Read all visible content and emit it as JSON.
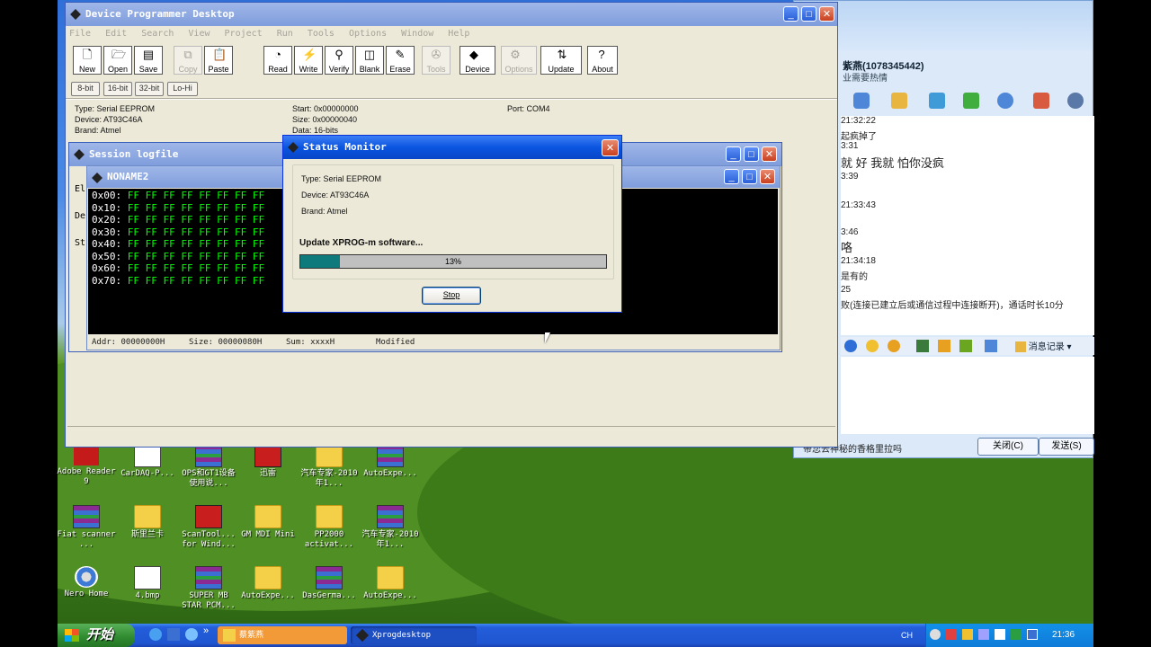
{
  "main_window": {
    "title": "Device Programmer Desktop",
    "menu": [
      "File",
      "Edit",
      "Search",
      "View",
      "Project",
      "Run",
      "Tools",
      "Options",
      "Window",
      "Help"
    ],
    "toolbar": [
      {
        "label": "New",
        "icon": "new-file-icon",
        "enabled": true
      },
      {
        "label": "Open",
        "icon": "open-file-icon",
        "enabled": true
      },
      {
        "label": "Save",
        "icon": "save-icon",
        "enabled": true
      },
      {
        "label": "Copy",
        "icon": "copy-icon",
        "enabled": false
      },
      {
        "label": "Paste",
        "icon": "paste-icon",
        "enabled": true
      },
      {
        "label": "Read",
        "icon": "read-icon",
        "enabled": true
      },
      {
        "label": "Write",
        "icon": "write-icon",
        "enabled": true
      },
      {
        "label": "Verify",
        "icon": "verify-icon",
        "enabled": true
      },
      {
        "label": "Blank",
        "icon": "blank-icon",
        "enabled": true
      },
      {
        "label": "Erase",
        "icon": "erase-icon",
        "enabled": true
      },
      {
        "label": "Tools",
        "icon": "tools-icon",
        "enabled": false
      },
      {
        "label": "Device",
        "icon": "device-icon",
        "enabled": true
      },
      {
        "label": "Options",
        "icon": "options-icon",
        "enabled": false
      },
      {
        "label": "Update",
        "icon": "update-icon",
        "enabled": true
      },
      {
        "label": "About",
        "icon": "about-icon",
        "enabled": true
      }
    ],
    "bit_buttons": [
      "8-bit",
      "16-bit",
      "32-bit",
      "Lo-Hi"
    ],
    "info": {
      "type": "Type: Serial EEPROM",
      "device": "Device: AT93C46A",
      "brand": "Brand: Atmel",
      "start": "Start: 0x00000000",
      "size": "Size: 0x00000040",
      "data": "Data: 16-bits",
      "port": "Port: COM4"
    }
  },
  "session_window": {
    "title": "Session logfile",
    "side_chars": [
      "El",
      "De",
      "St"
    ]
  },
  "hex_window": {
    "title": "NONAME2",
    "rows": [
      {
        "addr": "0x00:",
        "bytes": "FF FF FF FF FF FF FF FF"
      },
      {
        "addr": "0x10:",
        "bytes": "FF FF FF FF FF FF FF FF"
      },
      {
        "addr": "0x20:",
        "bytes": "FF FF FF FF FF FF FF FF"
      },
      {
        "addr": "0x30:",
        "bytes": "FF FF FF FF FF FF FF FF"
      },
      {
        "addr": "0x40:",
        "bytes": "FF FF FF FF FF FF FF FF"
      },
      {
        "addr": "0x50:",
        "bytes": "FF FF FF FF FF FF FF FF"
      },
      {
        "addr": "0x60:",
        "bytes": "FF FF FF FF FF FF FF FF"
      },
      {
        "addr": "0x70:",
        "bytes": "FF FF FF FF FF FF FF FF"
      }
    ],
    "status": {
      "addr": "Addr: 00000000H",
      "size": "Size: 00000080H",
      "sum": "Sum: xxxxH",
      "modified": "Modified"
    }
  },
  "status_dialog": {
    "title": "Status Monitor",
    "type": "Type: Serial EEPROM",
    "device": "Device: AT93C46A",
    "brand": "Brand: Atmel",
    "message": "Update XPROG-m software...",
    "progress_text": "13%",
    "progress": 0.13,
    "stop_label": "Stop"
  },
  "chat": {
    "header_name": "紫燕(1078345442)",
    "header_sub": "业需要热情",
    "lines": [
      {
        "text": "21:32:22",
        "kind": "time"
      },
      {
        "text": "起疯掉了",
        "kind": "msg"
      },
      {
        "text": "3:31",
        "kind": "time"
      },
      {
        "text": "就 好   我就 怕你没疯",
        "kind": "big"
      },
      {
        "text": "3:39",
        "kind": "time"
      },
      {
        "text": "21:33:43",
        "kind": "time"
      },
      {
        "text": "3:46",
        "kind": "time"
      },
      {
        "text": "咯",
        "kind": "big"
      },
      {
        "text": "21:34:18",
        "kind": "time"
      },
      {
        "text": "是有的",
        "kind": "msg"
      },
      {
        "text": "25",
        "kind": "time"
      },
      {
        "text": "败(连接已建立后或通信过程中连接断开)，通话时长10分",
        "kind": "msg"
      }
    ],
    "input_tool_label": "消息记录",
    "ad_text": "带您去神秘的香格里拉吗",
    "close_label": "关闭(C)",
    "send_label": "发送(S)"
  },
  "desktop_icons": [
    {
      "label": "Adobe Reader 9",
      "kind": "pdf"
    },
    {
      "label": "CarDAQ-P...",
      "kind": "doc"
    },
    {
      "label": "OPS和GT1设备使用说...",
      "kind": "rar"
    },
    {
      "label": "迅雷",
      "kind": "app"
    },
    {
      "label": "汽车专家-2010年1...",
      "kind": "folder"
    },
    {
      "label": "AutoExpe...",
      "kind": "rar"
    },
    {
      "label": "Fiat scanner ...",
      "kind": "rar"
    },
    {
      "label": "斯里兰卡",
      "kind": "folder"
    },
    {
      "label": "ScanTool... for Wind...",
      "kind": "app"
    },
    {
      "label": "GM MDI Mini",
      "kind": "folder"
    },
    {
      "label": "PP2000 activat...",
      "kind": "folder"
    },
    {
      "label": "汽车专家-2010年1...",
      "kind": "rar"
    },
    {
      "label": "Nero Home",
      "kind": "cd"
    },
    {
      "label": "4.bmp",
      "kind": "doc"
    },
    {
      "label": "SUPER MB STAR PCM...",
      "kind": "rar"
    },
    {
      "label": "AutoExpe...",
      "kind": "folder"
    },
    {
      "label": "DasGerma...",
      "kind": "rar"
    },
    {
      "label": "AutoExpe...",
      "kind": "folder"
    }
  ],
  "taskbar": {
    "start_label": "开始",
    "tasks": [
      {
        "label": "蔡紫燕",
        "icon": "chat-task-icon"
      },
      {
        "label": "Xprogdesktop",
        "icon": "xprog-task-icon"
      }
    ],
    "lang": "CH",
    "clock": "21:36"
  }
}
